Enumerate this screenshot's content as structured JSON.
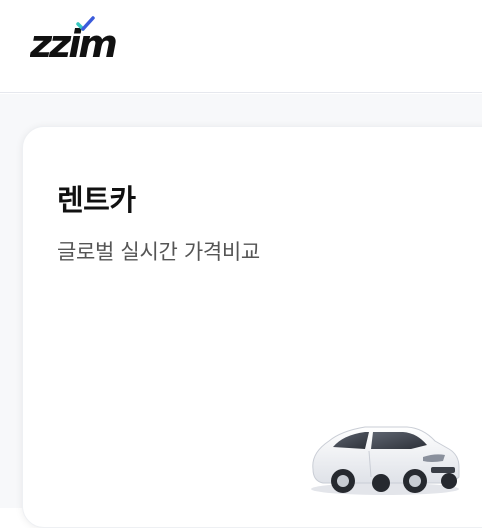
{
  "header": {
    "logo_text": "zzim",
    "logo_icon": "checkmark-icon"
  },
  "card": {
    "title": "렌트카",
    "subtitle": "글로벌 실시간 가격비교",
    "illustration": "car-icon"
  },
  "colors": {
    "logo": "#111111",
    "logo_check_teal": "#38c7c0",
    "logo_check_blue": "#3b5bdb",
    "title": "#111111",
    "subtitle": "#555555"
  }
}
